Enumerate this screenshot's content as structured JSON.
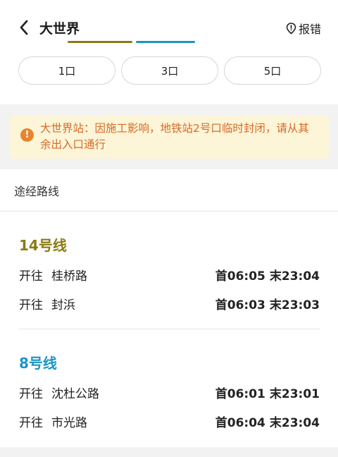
{
  "header": {
    "title": "大世界",
    "report_label": "报错"
  },
  "colors": {
    "line14": "#8a7a12",
    "line8": "#1a95c8",
    "notice_bg": "#fcf5d7",
    "notice_text": "#d86a28"
  },
  "exits": [
    "1口",
    "3口",
    "5口"
  ],
  "notice": {
    "text": "大世界站：因施工影响，地铁站2号口临时封闭，请从其余出入口通行"
  },
  "routes_section": {
    "title": "途经路线"
  },
  "lines": [
    {
      "name": "14号线",
      "directions": [
        {
          "prefix": "开往",
          "dest": "桂桥路",
          "first_label": "首",
          "first": "06:05",
          "last_label": "末",
          "last": "23:04"
        },
        {
          "prefix": "开往",
          "dest": "封浜",
          "first_label": "首",
          "first": "06:03",
          "last_label": "末",
          "last": "23:03"
        }
      ]
    },
    {
      "name": "8号线",
      "directions": [
        {
          "prefix": "开往",
          "dest": "沈杜公路",
          "first_label": "首",
          "first": "06:01",
          "last_label": "末",
          "last": "23:01"
        },
        {
          "prefix": "开往",
          "dest": "市光路",
          "first_label": "首",
          "first": "06:04",
          "last_label": "末",
          "last": "23:04"
        }
      ]
    }
  ]
}
